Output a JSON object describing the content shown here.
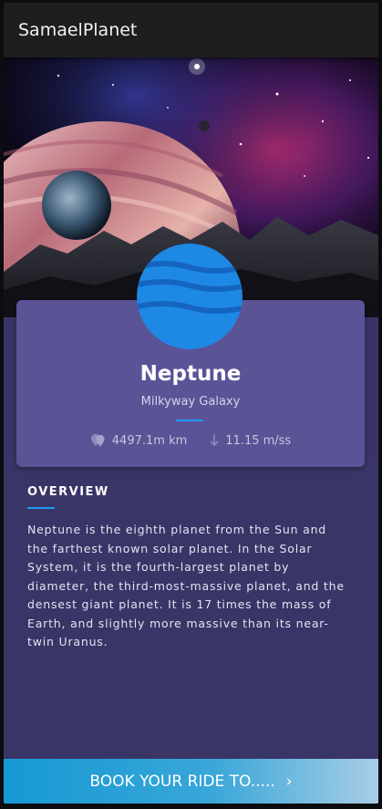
{
  "app": {
    "title": "SamaelPlanet"
  },
  "planet": {
    "name": "Neptune",
    "galaxy": "Milkyway Galaxy",
    "distance": "4497.1m km",
    "gravity": "11.15 m/ss",
    "color": "#1e88e5"
  },
  "overview": {
    "heading": "OVERVIEW",
    "text": "Neptune is the eighth planet from the Sun and the farthest known solar planet. In the Solar System, it is the fourth-largest planet by diameter, the third-most-massive planet, and the densest giant planet. It is 17 times the mass of Earth, and slightly more massive than its near-twin Uranus."
  },
  "actions": {
    "book_label": "BOOK YOUR RIDE TO.....",
    "book_icon": "chevron-right-icon"
  },
  "icons": {
    "distance": "location-pin-icon",
    "gravity": "arrow-down-icon"
  },
  "colors": {
    "accent": "#1e9bf0",
    "card": "#5a5396",
    "background": "#3a3567",
    "appbar": "#1e1e1f"
  }
}
